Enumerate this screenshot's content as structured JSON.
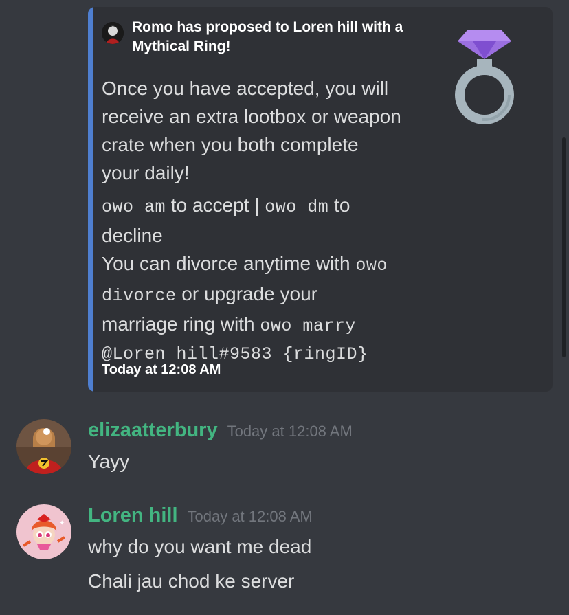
{
  "embed": {
    "accent_color": "#4f7fd0",
    "author": "Romo has proposed to Loren hill with a Mythical Ring!",
    "desc_line1": "Once you have accepted, you will",
    "desc_line2": "receive an extra lootbox or weapon",
    "desc_line3": "crate when you both complete",
    "desc_line4": "your daily!",
    "cmd_accept": "owo am",
    "to_accept": " to accept | ",
    "cmd_decline": "owo dm",
    "to_decline": " to",
    "decline_word": "decline",
    "divorce_text": "You can divorce anytime with ",
    "cmd_divorce_a": "owo",
    "cmd_divorce_b": "divorce",
    "upgrade_text": " or upgrade your",
    "marriage_text": "marriage ring with ",
    "cmd_marry": "owo marry",
    "cmd_marry_args": "@Loren hill#9583 {ringID}",
    "footer": "Today at 12:08 AM",
    "thumbnail_icon": "ring-icon"
  },
  "messages": [
    {
      "username": "elizaatterbury",
      "timestamp": "Today at 12:08 AM",
      "lines": [
        "Yayy"
      ]
    },
    {
      "username": "Loren hill",
      "timestamp": "Today at 12:08 AM",
      "lines": [
        "why do you want me dead",
        "Chali jau chod ke server"
      ]
    }
  ],
  "colors": {
    "background": "#36393f",
    "embed_bg": "#2f3136",
    "username": "#43b581",
    "timestamp": "#72767d"
  }
}
